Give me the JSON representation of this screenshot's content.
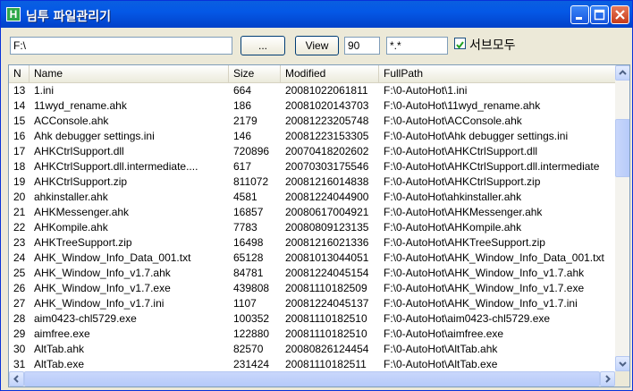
{
  "window": {
    "title": "님투 파일관리기",
    "icon_letter": "H"
  },
  "toolbar": {
    "path_value": "F:\\",
    "browse_label": "...",
    "view_label": "View",
    "limit_value": "90",
    "filter_value": "*.*",
    "subfolders_checked": true,
    "subfolders_label": "서브모두"
  },
  "columns": [
    "N",
    "Name",
    "Size",
    "Modified",
    "FullPath"
  ],
  "rows": [
    [
      "13",
      "1.ini",
      "664",
      "20081022061811",
      "F:\\0-AutoHot\\1.ini"
    ],
    [
      "14",
      "11wyd_rename.ahk",
      "186",
      "20081020143703",
      "F:\\0-AutoHot\\11wyd_rename.ahk"
    ],
    [
      "15",
      "ACConsole.ahk",
      "2179",
      "20081223205748",
      "F:\\0-AutoHot\\ACConsole.ahk"
    ],
    [
      "16",
      "Ahk debugger settings.ini",
      "146",
      "20081223153305",
      "F:\\0-AutoHot\\Ahk debugger settings.ini"
    ],
    [
      "17",
      "AHKCtrlSupport.dll",
      "720896",
      "20070418202602",
      "F:\\0-AutoHot\\AHKCtrlSupport.dll"
    ],
    [
      "18",
      "AHKCtrlSupport.dll.intermediate....",
      "617",
      "20070303175546",
      "F:\\0-AutoHot\\AHKCtrlSupport.dll.intermediate"
    ],
    [
      "19",
      "AHKCtrlSupport.zip",
      "811072",
      "20081216014838",
      "F:\\0-AutoHot\\AHKCtrlSupport.zip"
    ],
    [
      "20",
      "ahkinstaller.ahk",
      "4581",
      "20081224044900",
      "F:\\0-AutoHot\\ahkinstaller.ahk"
    ],
    [
      "21",
      "AHKMessenger.ahk",
      "16857",
      "20080617004921",
      "F:\\0-AutoHot\\AHKMessenger.ahk"
    ],
    [
      "22",
      "AHKompile.ahk",
      "7783",
      "20080809123135",
      "F:\\0-AutoHot\\AHKompile.ahk"
    ],
    [
      "23",
      "AHKTreeSupport.zip",
      "16498",
      "20081216021336",
      "F:\\0-AutoHot\\AHKTreeSupport.zip"
    ],
    [
      "24",
      "AHK_Window_Info_Data_001.txt",
      "65128",
      "20081013044051",
      "F:\\0-AutoHot\\AHK_Window_Info_Data_001.txt"
    ],
    [
      "25",
      "AHK_Window_Info_v1.7.ahk",
      "84781",
      "20081224045154",
      "F:\\0-AutoHot\\AHK_Window_Info_v1.7.ahk"
    ],
    [
      "26",
      "AHK_Window_Info_v1.7.exe",
      "439808",
      "20081110182509",
      "F:\\0-AutoHot\\AHK_Window_Info_v1.7.exe"
    ],
    [
      "27",
      "AHK_Window_Info_v1.7.ini",
      "1107",
      "20081224045137",
      "F:\\0-AutoHot\\AHK_Window_Info_v1.7.ini"
    ],
    [
      "28",
      "aim0423-chl5729.exe",
      "100352",
      "20081110182510",
      "F:\\0-AutoHot\\aim0423-chl5729.exe"
    ],
    [
      "29",
      "aimfree.exe",
      "122880",
      "20081110182510",
      "F:\\0-AutoHot\\aimfree.exe"
    ],
    [
      "30",
      "AltTab.ahk",
      "82570",
      "20080826124454",
      "F:\\0-AutoHot\\AltTab.ahk"
    ],
    [
      "31",
      "AltTab.exe",
      "231424",
      "20081110182511",
      "F:\\0-AutoHot\\AltTab.exe"
    ]
  ],
  "colors": {
    "titlebar": "#0458e6",
    "header": "#ebeadb",
    "close": "#c63b1a"
  }
}
